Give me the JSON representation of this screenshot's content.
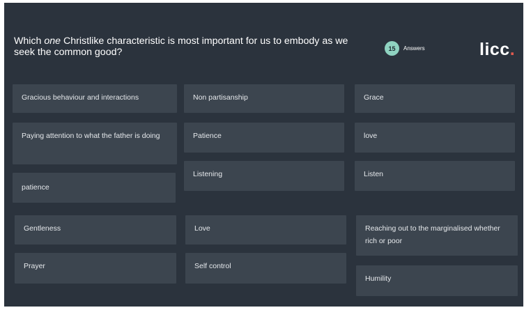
{
  "question": {
    "prefix": "Which ",
    "emphasis": "one",
    "suffix": " Christlike characteristic is most important for us to embody as we seek the common good?"
  },
  "answers": {
    "count": "15",
    "label": "Answers"
  },
  "logo": {
    "text": "licc",
    "dot": "."
  },
  "colors": {
    "background": "#2b333d",
    "card": "#3c454f",
    "badge": "#8fd3c1",
    "logo_dot": "#e05a4f"
  },
  "responses": [
    "Gracious behaviour and interactions",
    "Paying attention to what the father is doing",
    "patience",
    "Gentleness",
    "Prayer",
    "Non partisanship",
    "Patience",
    "Listening",
    "Love",
    "Self control",
    "Grace",
    "love",
    "Listen",
    "Reaching out to the marginalised whether rich or poor",
    "Humility"
  ]
}
